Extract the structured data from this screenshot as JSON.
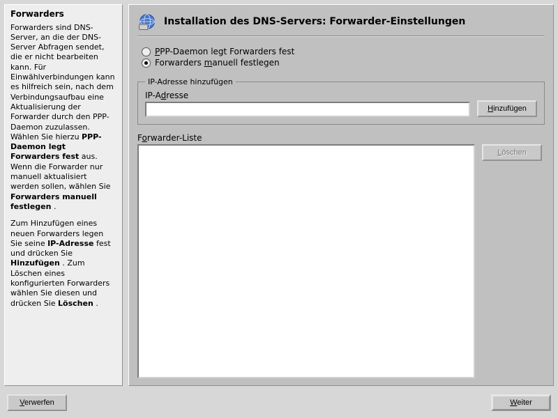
{
  "help": {
    "heading": "Forwarders",
    "para1_a": "Forwarders sind DNS-Server, an die der DNS-Server Abfragen sendet, die er nicht bearbeiten kann. Für Einwählverbindungen kann es hilfreich sein, nach dem Verbindungsaufbau eine Aktualisierung der Forwarder durch den PPP-Daemon zuzulassen. Wählen Sie hierzu ",
    "opt1": "PPP-Daemon legt Forwarders fest",
    "mid1": " aus. Wenn die Forwarder nur manuell aktualisiert werden sollen, wählen Sie ",
    "opt2": "Forwarders manuell festlegen",
    "end1": ".",
    "para2_a": "Zum Hinzufügen eines neuen Forwarders legen Sie seine ",
    "ipaddr": "IP-Adresse",
    "para2_b": " fest und drücken Sie ",
    "add": "Hinzufügen",
    "para2_c": ". Zum Löschen eines konfigurierten Forwarders wählen Sie diesen und drücken Sie ",
    "del": "Löschen",
    "end2": "."
  },
  "main": {
    "title": "Installation des DNS-Servers: Forwarder-Einstellungen",
    "radio_ppp_pre": "P",
    "radio_ppp_rest": "PP-Daemon legt Forwarders fest",
    "radio_man_pre": "Forwarders ",
    "radio_man_accel": "m",
    "radio_man_rest": "anuell festlegen",
    "radio_selected": "manual",
    "groupbox_title": "IP-Adresse hinzufügen",
    "ip_label_pre": "IP-A",
    "ip_label_accel": "d",
    "ip_label_rest": "resse",
    "ip_value": "",
    "add_btn_accel": "H",
    "add_btn_rest": "inzufügen",
    "list_label_pre": "F",
    "list_label_accel": "o",
    "list_label_rest": "rwarder-Liste",
    "del_btn_accel": "L",
    "del_btn_rest": "öschen",
    "forwarders": []
  },
  "buttons": {
    "abort_accel": "V",
    "abort_rest": "erwerfen",
    "next_accel": "W",
    "next_rest": "eiter"
  }
}
